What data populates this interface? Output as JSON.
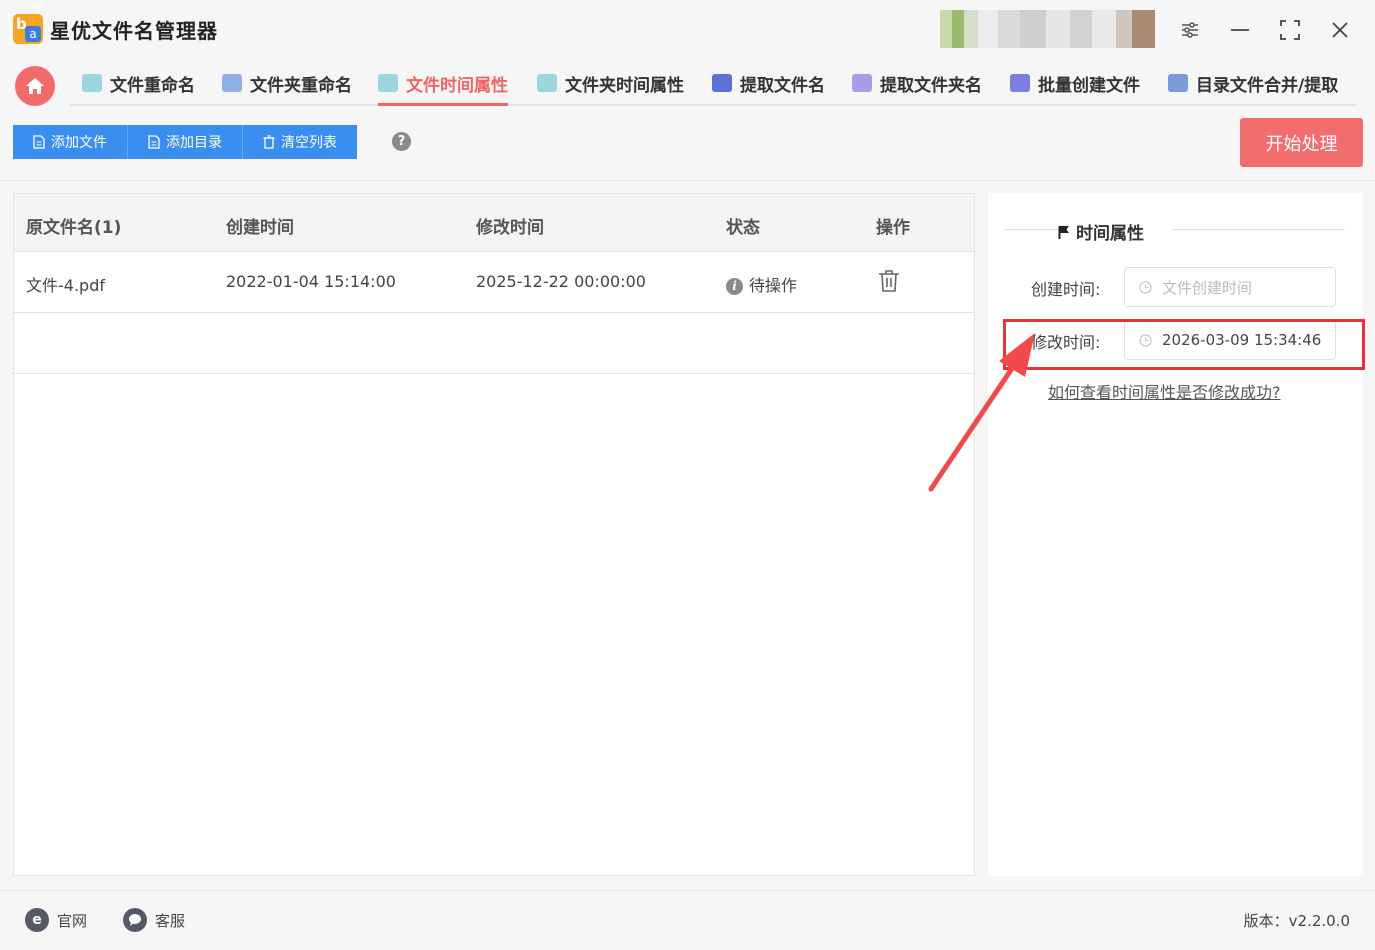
{
  "app": {
    "title": "星优文件名管理器"
  },
  "tabs": [
    {
      "label": "文件重命名",
      "color": "#3fb6c8"
    },
    {
      "label": "文件夹重命名",
      "color": "#4a7fd4"
    },
    {
      "label": "文件时间属性",
      "color": "#3fb6c8"
    },
    {
      "label": "文件夹时间属性",
      "color": "#3fb6c8"
    },
    {
      "label": "提取文件名",
      "color": "#3a5bd1"
    },
    {
      "label": "提取文件夹名",
      "color": "#7a6fd8"
    },
    {
      "label": "批量创建文件",
      "color": "#5a60d8"
    },
    {
      "label": "目录文件合并/提取",
      "color": "#4a7fd4"
    }
  ],
  "active_tab": "文件时间属性",
  "toolbar": {
    "add_file": "添加文件",
    "add_dir": "添加目录",
    "clear_list": "清空列表",
    "start": "开始处理"
  },
  "table": {
    "headers": [
      "原文件名(1)",
      "创建时间",
      "修改时间",
      "状态",
      "操作"
    ],
    "rows": [
      {
        "name": "文件-4.pdf",
        "created": "2022-01-04 15:14:00",
        "modified": "2025-12-22 00:00:00",
        "status": "待操作"
      }
    ]
  },
  "side": {
    "section_title": "时间属性",
    "created_label": "创建时间:",
    "created_placeholder": "文件创建时间",
    "modified_label": "修改时间:",
    "modified_value": "2026-03-09 15:34:46",
    "help_link": "如何查看时间属性是否修改成功?"
  },
  "footer": {
    "website": "官网",
    "support": "客服",
    "version": "版本：v2.2.0.0"
  },
  "colors": {
    "accent": "#ef6464",
    "primary": "#3a8ef0",
    "highlight": "#e8323a"
  }
}
